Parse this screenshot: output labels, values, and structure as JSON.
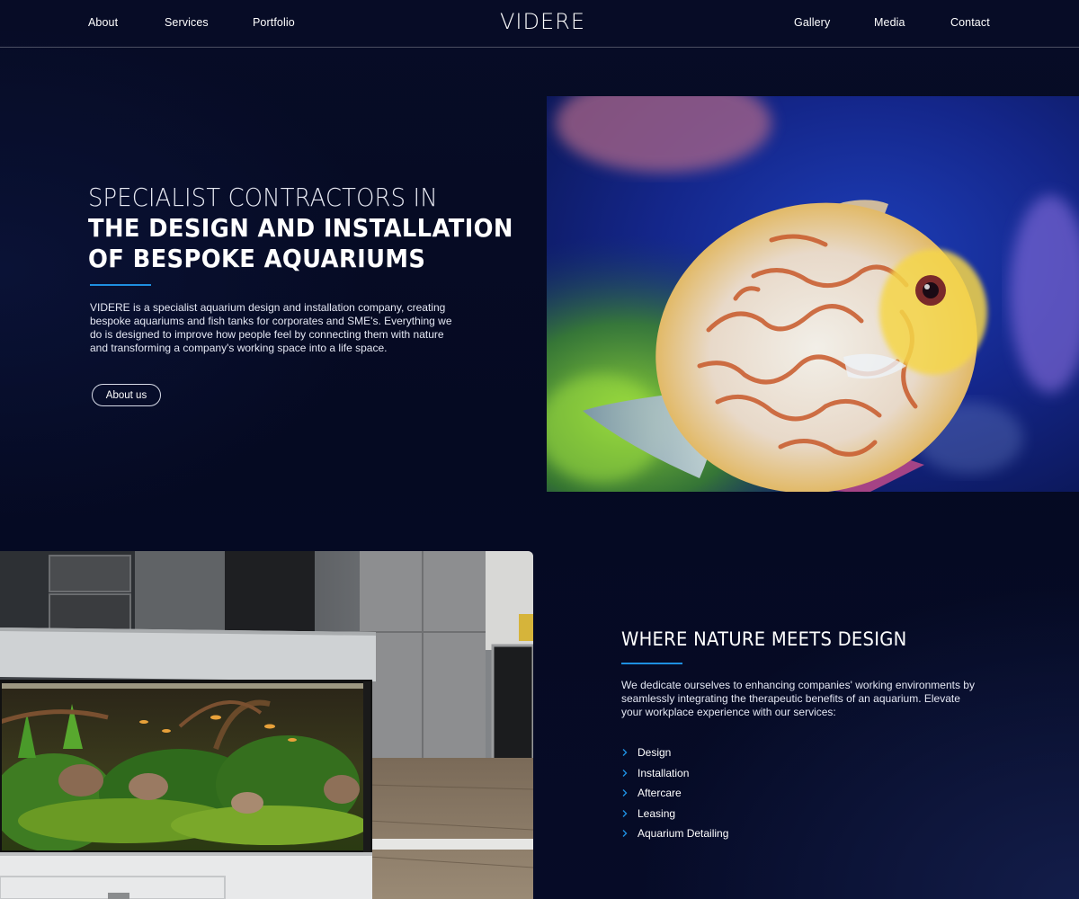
{
  "nav": {
    "left": [
      "About",
      "Services",
      "Portfolio"
    ],
    "logo": "VIDERE",
    "right": [
      "Gallery",
      "Media",
      "Contact"
    ]
  },
  "hero": {
    "title_line1": "SPECIALIST CONTRACTORS IN",
    "title_line2": "THE DESIGN AND INSTALLATION",
    "title_line3": "OF BESPOKE AQUARIUMS",
    "description": [
      "VIDERE is a specialist aquarium design and installation company, creating",
      "bespoke aquariums and fish tanks for corporates and SME's. Everything we",
      "do is designed to improve how people feel by connecting them with nature",
      "and transforming a company's working space into a life space."
    ],
    "button_label": "About us"
  },
  "section2": {
    "title": "WHERE NATURE MEETS DESIGN",
    "description": [
      "We dedicate ourselves to enhancing companies' working environments by",
      "seamlessly integrating the therapeutic benefits of an aquarium. Elevate",
      "your workplace experience with our services:"
    ],
    "services": [
      "Design",
      "Installation",
      "Aftercare",
      "Leasing",
      "Aquarium Detailing"
    ]
  },
  "colors": {
    "background": "#050a22",
    "accent": "#1e8fe0",
    "text": "#ffffff"
  }
}
